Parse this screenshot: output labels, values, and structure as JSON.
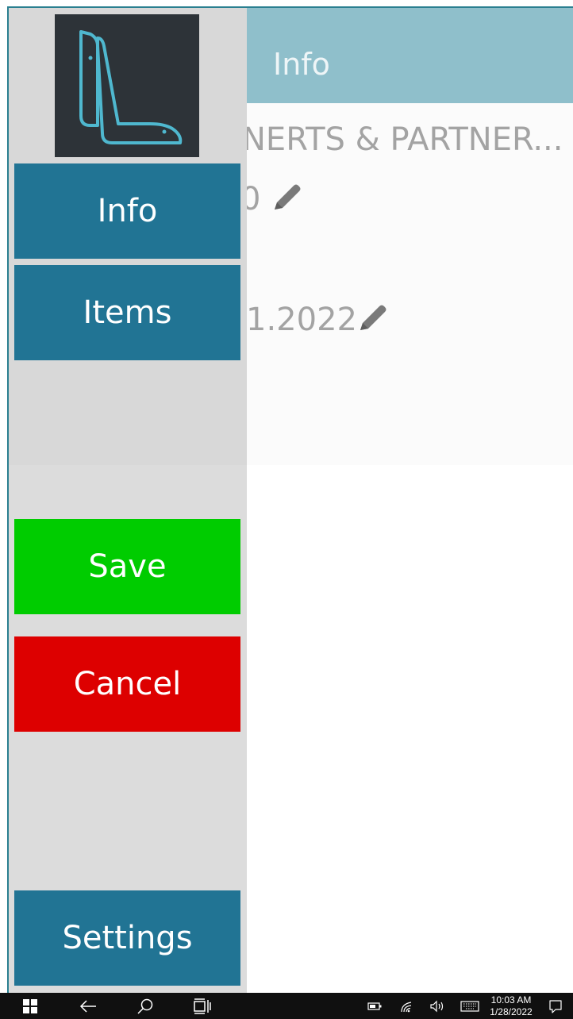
{
  "header": {
    "title": "Info"
  },
  "content": {
    "company_name": "NERTS & PARTNER...",
    "number_value": "0",
    "date_value": "1.2022"
  },
  "nav": {
    "info_label": "Info",
    "items_label": "Items",
    "save_label": "Save",
    "cancel_label": "Cancel",
    "settings_label": "Settings"
  },
  "taskbar": {
    "time": "10:03 AM",
    "date": "1/28/2022"
  },
  "colors": {
    "header": "#8fbfcb",
    "nav_blue": "#217494",
    "save_green": "#00cc00",
    "cancel_red": "#dd0000",
    "logo_bg": "#2d3338",
    "logo_accent": "#4fb8cf"
  },
  "icons": [
    "pencil-icon",
    "windows-start-icon",
    "back-arrow-icon",
    "search-icon",
    "task-view-icon",
    "battery-icon",
    "wifi-icon",
    "volume-icon",
    "keyboard-icon",
    "notification-icon"
  ]
}
